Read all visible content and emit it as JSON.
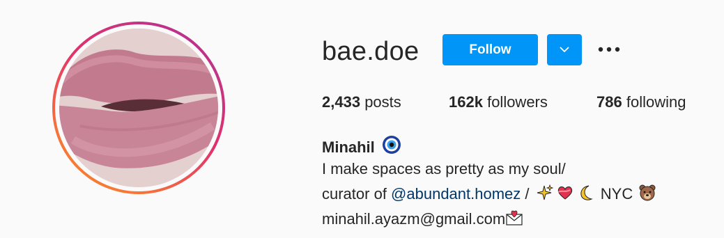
{
  "profile": {
    "username": "bae.doe",
    "full_name": "Minahil",
    "name_emoji_icon": "nazar-amulet-icon",
    "avatar_icon": "lips-photo"
  },
  "actions": {
    "follow_label": "Follow",
    "dropdown_icon": "chevron-down-icon",
    "more_icon": "ellipsis-icon",
    "accent": "#0095f6"
  },
  "stats": {
    "posts_count": "2,433",
    "posts_label": "posts",
    "followers_count": "162k",
    "followers_label": "followers",
    "following_count": "786",
    "following_label": "following"
  },
  "bio": {
    "line1": "I make spaces as pretty as my soul/",
    "line2_prefix": "curator of ",
    "line2_mention": "@abundant.homez",
    "line2_sep": " / ",
    "line2_emojis": [
      "sparkles-icon",
      "heart-icon",
      "crescent-moon-icon"
    ],
    "line2_city": " NYC ",
    "line2_end_emoji": "bear-face-icon",
    "line3_email": "minahil.ayazm@gmail.com",
    "line3_emoji": "love-letter-icon"
  }
}
